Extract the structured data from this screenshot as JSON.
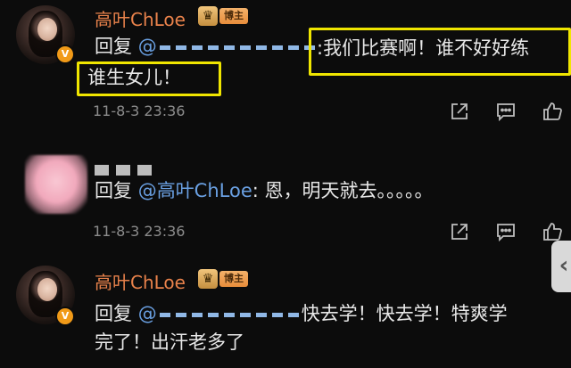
{
  "comments": [
    {
      "username": "高叶ChLoe",
      "owner_badge": "博主",
      "verified_symbol": "V",
      "crown_symbol": "♛",
      "reply_label": "回复",
      "mention_prefix": "@",
      "text_first": ":我们比赛啊！谁不好好练",
      "text_second": "谁生女儿！",
      "timestamp": "11-8-3 23:36"
    },
    {
      "reply_label": "回复",
      "mention": "@高叶ChLoe",
      "text": ": 恩，明天就去。。。。。",
      "timestamp": "11-8-3 23:36"
    },
    {
      "username": "高叶ChLoe",
      "owner_badge": "博主",
      "verified_symbol": "V",
      "crown_symbol": "♛",
      "reply_label": "回复",
      "mention_prefix": "@",
      "text_first": "快去学！快去学！特爽学",
      "text_second": "完了！出汗老多了"
    }
  ],
  "scroll_handle_symbol": "‹",
  "accent_colors": {
    "username": "#e9824b",
    "mention": "#6aa0e2",
    "highlight": "#f0e600",
    "badge": "#f19a18"
  },
  "icons": [
    "share-icon",
    "comment-icon",
    "like-icon"
  ]
}
